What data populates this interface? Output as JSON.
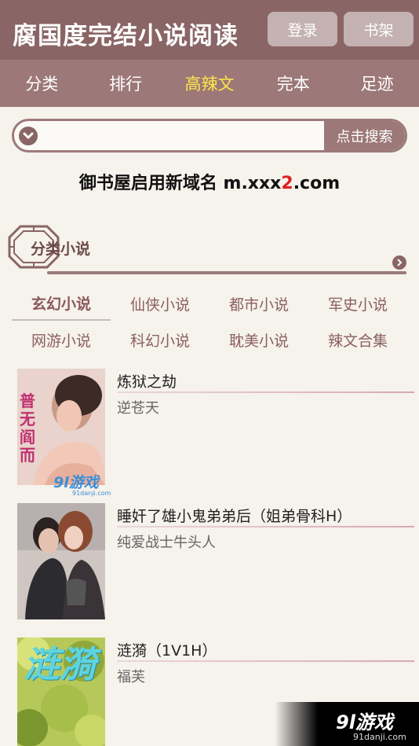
{
  "header": {
    "title": "腐国度完结小说阅读",
    "login_label": "登录",
    "shelf_label": "书架"
  },
  "nav": {
    "items": [
      "分类",
      "排行",
      "高辣文",
      "完本",
      "足迹"
    ],
    "active_index": 2
  },
  "search": {
    "placeholder": "",
    "button_label": "点击搜索"
  },
  "notice": {
    "prefix": "御书屋启用新域名 m.xxx",
    "highlight": "2",
    "suffix": ".com"
  },
  "section": {
    "title": "分类小说"
  },
  "categories": {
    "items": [
      "玄幻小说",
      "仙侠小说",
      "都市小说",
      "军史小说",
      "网游小说",
      "科幻小说",
      "耽美小说",
      "辣文合集"
    ],
    "active_index": 0
  },
  "books": [
    {
      "title": "炼狱之劫",
      "author": "逆苍天",
      "cover_text": "普无阎而"
    },
    {
      "title": "睡奸了雄小鬼弟弟后（姐弟骨科H）",
      "author": "纯爱战士牛头人",
      "cover_text": ""
    },
    {
      "title": "涟漪（1V1H）",
      "author": "福芙",
      "cover_text": "涟漪"
    }
  ],
  "watermarks": {
    "cover_logo": "9l游戏",
    "cover_url": "91danji.com",
    "corner_logo": "9l游戏",
    "corner_url": "91danji.com"
  },
  "colors": {
    "header_bg": "#8a6565",
    "nav_bg": "#9c7878",
    "nav_active": "#ffe94a",
    "notice_highlight": "#e02020"
  }
}
